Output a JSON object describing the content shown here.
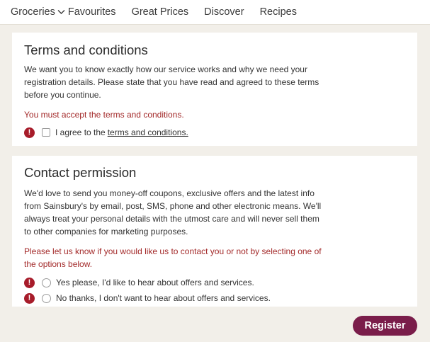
{
  "nav": {
    "items": [
      "Groceries",
      "Favourites",
      "Great Prices",
      "Discover",
      "Recipes"
    ],
    "groceries_icon": "chevron-down-icon"
  },
  "terms": {
    "title": "Terms and conditions",
    "body": "We want you to know exactly how our service works and why we need your registration details. Please state that you have read and agreed to these terms before you continue.",
    "error": "You must accept the terms and conditions.",
    "checkbox_prefix": "I agree to the ",
    "checkbox_link": "terms and conditions.",
    "checked": false
  },
  "contact": {
    "title": "Contact permission",
    "body": "We'd love to send you money-off coupons, exclusive offers and the latest info from Sainsbury's by email, post, SMS, phone and other electronic means. We'll always treat your personal details with the utmost care and will never sell them to other companies for marketing purposes.",
    "error": "Please let us know if you would like us to contact you or not by selecting one of the options below.",
    "option_yes": "Yes please, I'd like to hear about offers and services.",
    "option_no": "No thanks, I don't want to hear about offers and services.",
    "selected": null
  },
  "actions": {
    "register_label": "Register"
  },
  "colors": {
    "brand": "#7a1d4a",
    "error": "#a32a2a",
    "alert_icon": "#a71c2a",
    "page_bg": "#f2efe9"
  }
}
